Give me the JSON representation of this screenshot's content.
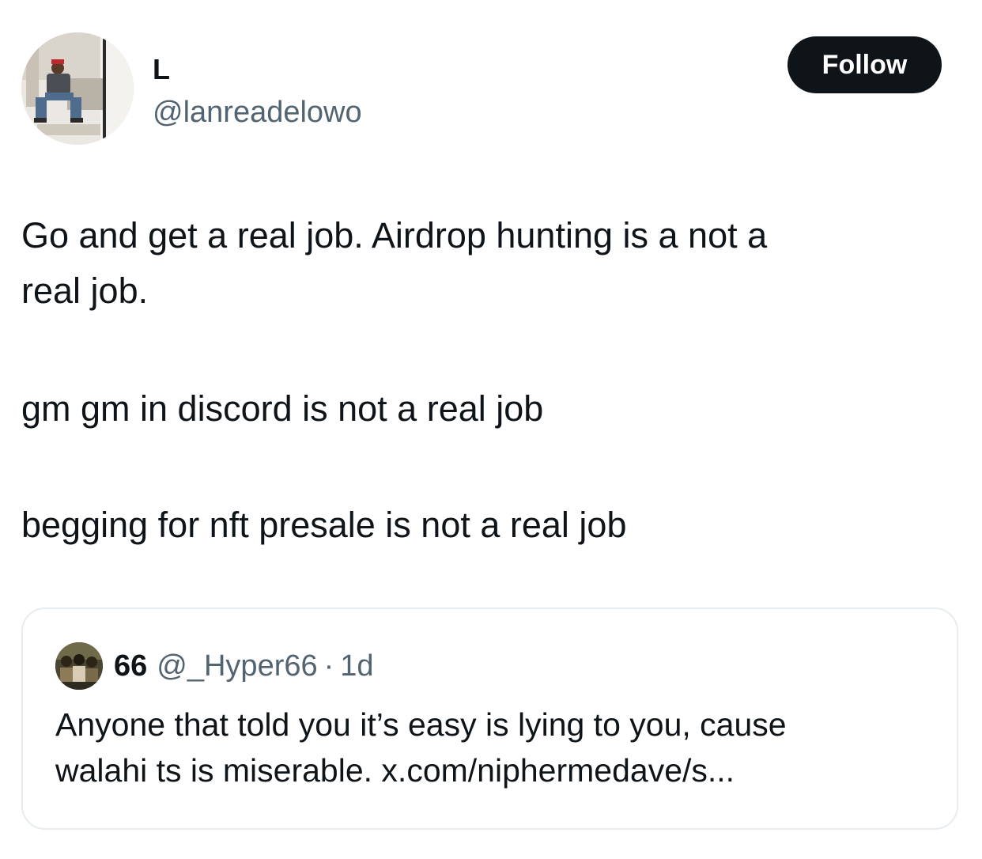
{
  "author": {
    "display_name": "L",
    "handle": "@lanreadelowo",
    "avatar_icon": "profile-photo"
  },
  "follow_button": {
    "label": "Follow"
  },
  "tweet": {
    "paragraphs": [
      "Go and get a real job. Airdrop hunting is a not a",
      "real job.",
      "gm gm in discord is not a real job",
      "begging for nft presale is not a real job"
    ]
  },
  "quoted_tweet": {
    "display_name": "66",
    "handle": "@_Hyper66",
    "separator": "·",
    "time": "1d",
    "text_line1": "Anyone that told you it’s easy is lying to you, cause",
    "text_line2": "walahi ts is miserable. x.com/niphermedave/s..."
  },
  "colors": {
    "text_primary": "#0f1419",
    "text_secondary": "#536471",
    "button_bg": "#0f1419",
    "border": "#e6ecf0"
  }
}
